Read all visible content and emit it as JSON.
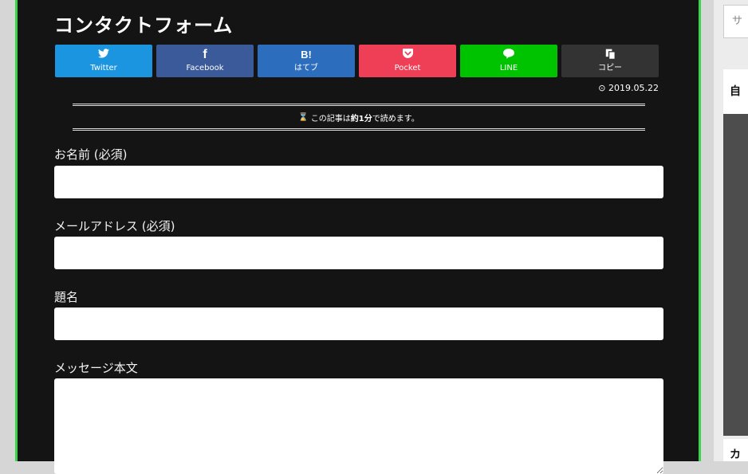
{
  "page": {
    "title": "コンタクトフォーム"
  },
  "share": [
    {
      "icon": "twitter-icon",
      "glyph": "🐦",
      "label": "Twitter",
      "color": "#1b95e0"
    },
    {
      "icon": "facebook-icon",
      "glyph": "f",
      "label": "Facebook",
      "color": "#3b5a9a"
    },
    {
      "icon": "hatena-icon",
      "glyph": "B!",
      "label": "はてブ",
      "color": "#2c6ebd"
    },
    {
      "icon": "pocket-icon",
      "glyph": "⌵",
      "label": "Pocket",
      "color": "#ef3f56"
    },
    {
      "icon": "line-icon",
      "glyph": "●",
      "label": "LINE",
      "color": "#00c300"
    },
    {
      "icon": "copy-icon",
      "glyph": "⧉",
      "label": "コピー",
      "color": "#333333"
    }
  ],
  "meta": {
    "date": "2019.05.22",
    "readtime_prefix": "この記事は",
    "readtime_bold": "約1分",
    "readtime_suffix": "で読めます。"
  },
  "form": {
    "name_label": "お名前 (必須)",
    "email_label": "メールアドレス (必須)",
    "subject_label": "題名",
    "message_label": "メッセージ本文"
  },
  "sidebar": {
    "search_placeholder": "サ",
    "widget_heading": "自",
    "widget2_heading": "カ"
  }
}
